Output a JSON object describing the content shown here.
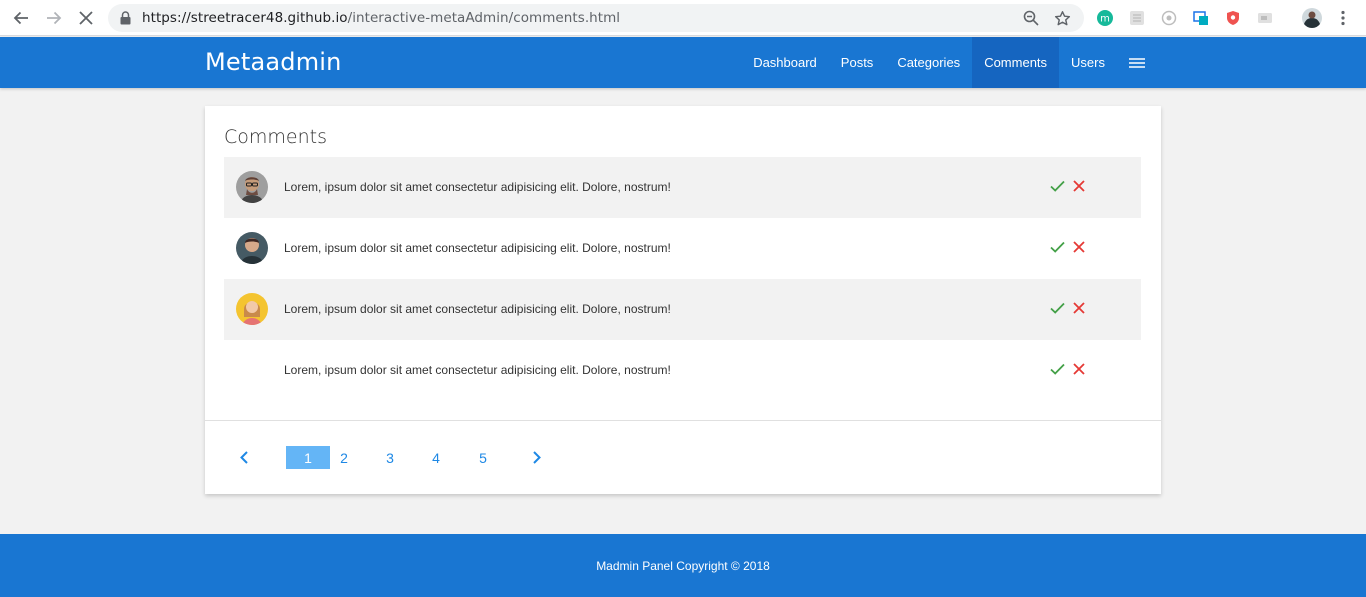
{
  "browser": {
    "url_host": "https://streetracer48.github.io",
    "url_path": "/interactive-metaAdmin/comments.html"
  },
  "navbar": {
    "brand": "Metaadmin",
    "items": [
      {
        "label": "Dashboard",
        "active": false
      },
      {
        "label": "Posts",
        "active": false
      },
      {
        "label": "Categories",
        "active": false
      },
      {
        "label": "Comments",
        "active": true
      },
      {
        "label": "Users",
        "active": false
      }
    ],
    "menu_icon": "hamburger-icon"
  },
  "card": {
    "title": "Comments",
    "comments": [
      {
        "text": "Lorem, ipsum dolor sit amet consectetur adipisicing elit. Dolore, nostrum!",
        "avatar": "man-glasses"
      },
      {
        "text": "Lorem, ipsum dolor sit amet consectetur adipisicing elit. Dolore, nostrum!",
        "avatar": "man-dark"
      },
      {
        "text": "Lorem, ipsum dolor sit amet consectetur adipisicing elit. Dolore, nostrum!",
        "avatar": "woman-yellow"
      },
      {
        "text": "Lorem, ipsum dolor sit amet consectetur adipisicing elit. Dolore, nostrum!",
        "avatar": "blank"
      }
    ],
    "approve_icon": "check-icon",
    "reject_icon": "close-icon"
  },
  "pagination": {
    "pages": [
      "1",
      "2",
      "3",
      "4",
      "5"
    ],
    "current": "1",
    "prev_icon": "chevron-left-icon",
    "next_icon": "chevron-right-icon"
  },
  "footer": {
    "text": "Madmin Panel Copyright © 2018"
  },
  "colors": {
    "primary": "#1976d2",
    "active_nav": "#1565c0",
    "approve": "#43a047",
    "reject": "#e53935",
    "page_active": "#64b5f6",
    "page_link": "#1e88e5"
  }
}
